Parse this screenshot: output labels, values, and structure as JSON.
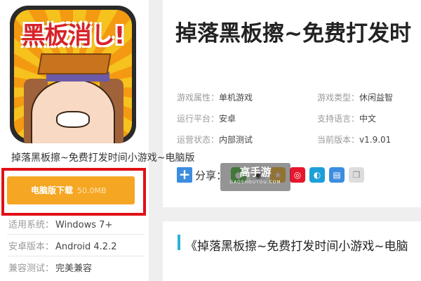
{
  "app": {
    "icon_text": "黑板消し!",
    "name": "掉落黑板擦~免费打发时间小游戏~电脑版",
    "title": "掉落黑板擦~免费打发时"
  },
  "download": {
    "label": "电脑版下载",
    "size": "50.0MB",
    "color": "#f5a623",
    "highlight_color": "#e01017"
  },
  "specs": [
    {
      "key": "适用系统：",
      "value": "Windows 7+"
    },
    {
      "key": "安卓版本：",
      "value": "Android 4.2.2"
    },
    {
      "key": "兼容测试：",
      "value": "完美兼容"
    }
  ],
  "attributes": {
    "game_attr": {
      "key": "游戏属性：",
      "value": "单机游戏"
    },
    "game_type": {
      "key": "游戏类型：",
      "value": "休闲益智"
    },
    "platform": {
      "key": "运行平台：",
      "value": "安卓"
    },
    "language": {
      "key": "支持语言：",
      "value": "中文"
    },
    "status": {
      "key": "运营状态：",
      "value": "内部测试"
    },
    "version": {
      "key": "当前版本：",
      "value": "v1.9.01"
    }
  },
  "share": {
    "label": "分享：",
    "icons": [
      "wechat-icon",
      "qq-icon",
      "qzone-icon",
      "weibo-icon",
      "tencent-weibo-icon",
      "print-icon",
      "copy-icon"
    ]
  },
  "watermark": {
    "main": "高手游",
    "sub": "GAOSHOUYOU.COM"
  },
  "section": {
    "title": "《掉落黑板擦~免费打发时间小游戏~电脑"
  }
}
